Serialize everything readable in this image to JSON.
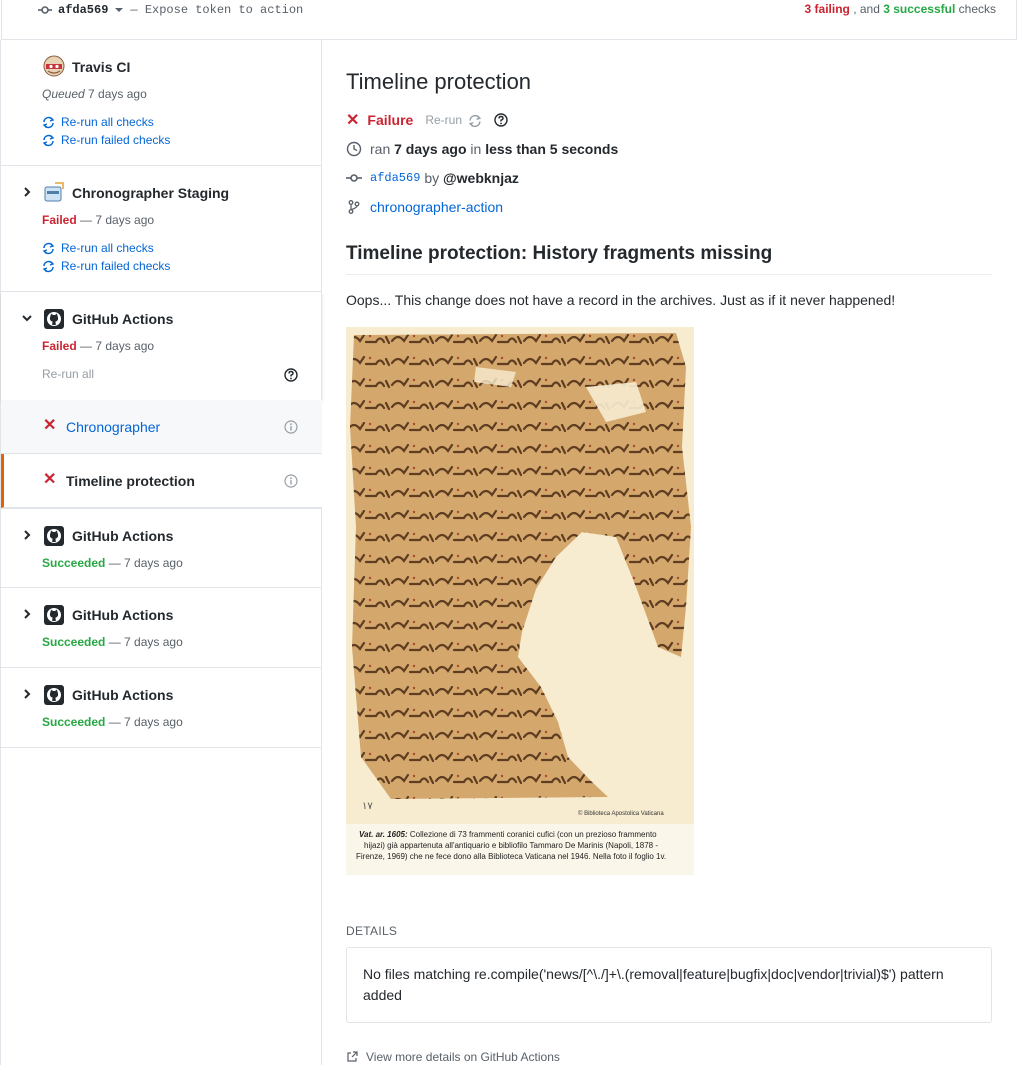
{
  "topbar": {
    "sha": "afda569",
    "message": "— Expose token to action",
    "failing": "3 failing",
    "and_sep": ", and",
    "successful": "3 successful",
    "checks": "checks"
  },
  "sidebar": {
    "suites": [
      {
        "name": "Travis CI",
        "state": "Queued",
        "time": "7 days ago",
        "rerun_all": "Re-run all checks",
        "rerun_failed": "Re-run failed checks"
      },
      {
        "name": "Chronographer Staging",
        "state": "Failed",
        "time": "— 7 days ago",
        "rerun_all": "Re-run all checks",
        "rerun_failed": "Re-run failed checks"
      },
      {
        "name": "GitHub Actions",
        "state": "Failed",
        "time": "— 7 days ago",
        "rerun_all": "Re-run all"
      },
      {
        "name": "GitHub Actions",
        "state": "Succeeded",
        "time": "— 7 days ago"
      },
      {
        "name": "GitHub Actions",
        "state": "Succeeded",
        "time": "— 7 days ago"
      },
      {
        "name": "GitHub Actions",
        "state": "Succeeded",
        "time": "— 7 days ago"
      }
    ],
    "runs": [
      {
        "name": "Chronographer"
      },
      {
        "name": "Timeline protection"
      }
    ]
  },
  "main": {
    "title": "Timeline protection",
    "status": "Failure",
    "rerun": "Re-run",
    "ran": "ran",
    "ran_when": "7 days ago",
    "in": "in",
    "duration": "less than 5 seconds",
    "sha": "afda569",
    "by": "by",
    "author": "@webknjaz",
    "branch": "chronographer-action",
    "heading": "Timeline protection: History fragments missing",
    "paragraph": "Oops... This change does not have a record in the archives. Just as if it never happened!",
    "image_caption_title": "Vat. ar. 1605:",
    "image_caption_line1": " Collezione di 73 frammenti coranici cufici (con un prezioso frammento",
    "image_caption_line2": "hijazi) già appartenuta all'antiquario e bibliofilo Tammaro De Marinis (Napoli, 1878 -",
    "image_caption_line3": "Firenze, 1969) che ne fece dono alla Biblioteca Vaticana nel 1946. Nella foto il foglio 1v.",
    "image_credit": "© Biblioteca Apostolica Vaticana",
    "folio_mark": "١٧",
    "details_label": "DETAILS",
    "details_text": "No files matching re.compile('news/[^\\./]+\\.(removal|feature|bugfix|doc|vendor|trivial)$') pattern added",
    "more_link": "View more details on GitHub Actions"
  },
  "colors": {
    "failure": "#cb2431",
    "success": "#28a745",
    "link": "#0366d6",
    "selected_accent": "#e36209"
  }
}
